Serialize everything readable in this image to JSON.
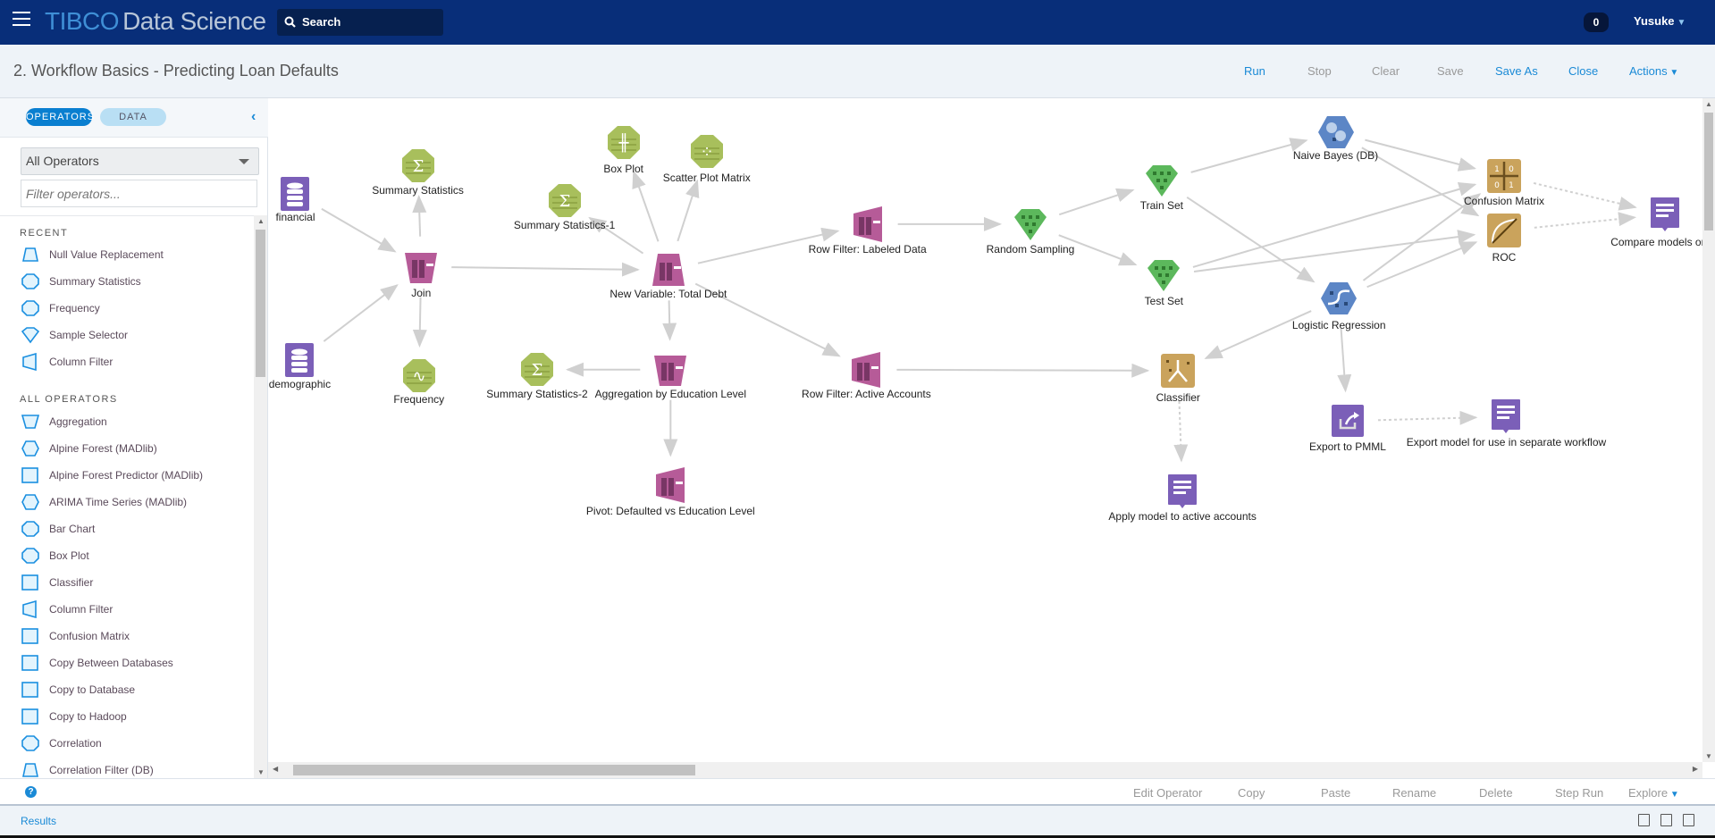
{
  "header": {
    "brand": "TIBCO",
    "product": "Data Science",
    "search_label": "Search",
    "notifications": "0",
    "user": "Yusuke"
  },
  "titlebar": {
    "title": "2. Workflow Basics - Predicting Loan Defaults",
    "buttons": [
      {
        "label": "Run",
        "enabled": true
      },
      {
        "label": "Stop",
        "enabled": false
      },
      {
        "label": "Clear",
        "enabled": false
      },
      {
        "label": "Save",
        "enabled": false
      },
      {
        "label": "Save As",
        "enabled": true
      },
      {
        "label": "Close",
        "enabled": true
      },
      {
        "label": "Actions",
        "enabled": true
      }
    ]
  },
  "sidebar": {
    "tabs": {
      "operators": "OPERATORS",
      "data": "DATA"
    },
    "category": "All Operators",
    "filter_placeholder": "Filter operators...",
    "recent_header": "RECENT",
    "recent": [
      {
        "label": "Null Value Replacement",
        "shape": "trapezoid"
      },
      {
        "label": "Summary Statistics",
        "shape": "octagon"
      },
      {
        "label": "Frequency",
        "shape": "octagon"
      },
      {
        "label": "Sample Selector",
        "shape": "gem"
      },
      {
        "label": "Column Filter",
        "shape": "quad"
      }
    ],
    "all_header": "ALL OPERATORS",
    "all": [
      {
        "label": "Aggregation",
        "shape": "inv-trapezoid"
      },
      {
        "label": "Alpine Forest (MADlib)",
        "shape": "hexagon"
      },
      {
        "label": "Alpine Forest Predictor (MADlib)",
        "shape": "square"
      },
      {
        "label": "ARIMA Time Series (MADlib)",
        "shape": "hexagon"
      },
      {
        "label": "Bar Chart",
        "shape": "octagon"
      },
      {
        "label": "Box Plot",
        "shape": "octagon"
      },
      {
        "label": "Classifier",
        "shape": "square"
      },
      {
        "label": "Column Filter",
        "shape": "quad"
      },
      {
        "label": "Confusion Matrix",
        "shape": "square"
      },
      {
        "label": "Copy Between Databases",
        "shape": "square"
      },
      {
        "label": "Copy to Database",
        "shape": "square"
      },
      {
        "label": "Copy to Hadoop",
        "shape": "square"
      },
      {
        "label": "Correlation",
        "shape": "octagon"
      },
      {
        "label": "Correlation Filter (DB)",
        "shape": "trapezoid"
      }
    ]
  },
  "canvas": {
    "colors": {
      "dataset": "#7b5fb8",
      "stats": "#a8bf5c",
      "transform": "#b65b98",
      "sample": "#5cb85c",
      "model": "#5c86c6",
      "evaluator": "#caa35c",
      "note": "#7b5fb8",
      "edge": "#d0d0d0"
    },
    "nodes": [
      {
        "label": "financial",
        "kind": "dataset",
        "icon": "database-icon"
      },
      {
        "label": "demographic",
        "kind": "dataset",
        "icon": "database-icon"
      },
      {
        "label": "Summary Statistics",
        "kind": "stats",
        "icon": "sigma-icon"
      },
      {
        "label": "Join",
        "kind": "transform",
        "icon": "join-icon"
      },
      {
        "label": "Frequency",
        "kind": "stats",
        "icon": "frequency-icon"
      },
      {
        "label": "Summary Statistics-1",
        "kind": "stats",
        "icon": "sigma-icon"
      },
      {
        "label": "Box Plot",
        "kind": "stats",
        "icon": "box-plot-icon"
      },
      {
        "label": "Scatter Plot Matrix",
        "kind": "stats",
        "icon": "scatter-icon"
      },
      {
        "label": "New Variable: Total Debt",
        "kind": "transform",
        "icon": "new-variable-icon"
      },
      {
        "label": "Summary Statistics-2",
        "kind": "stats",
        "icon": "sigma-icon"
      },
      {
        "label": "Aggregation by Education Level",
        "kind": "transform",
        "icon": "aggregation-icon"
      },
      {
        "label": "Pivot: Defaulted vs Education Level",
        "kind": "transform",
        "icon": "pivot-icon"
      },
      {
        "label": "Row Filter: Labeled Data",
        "kind": "transform",
        "icon": "row-filter-icon"
      },
      {
        "label": "Row Filter: Active Accounts",
        "kind": "transform",
        "icon": "row-filter-icon"
      },
      {
        "label": "Random Sampling",
        "kind": "sample",
        "icon": "sampling-icon"
      },
      {
        "label": "Train Set",
        "kind": "sample",
        "icon": "sample-selector-icon"
      },
      {
        "label": "Test Set",
        "kind": "sample",
        "icon": "sample-selector-icon"
      },
      {
        "label": "Naive Bayes (DB)",
        "kind": "model",
        "icon": "naive-bayes-icon"
      },
      {
        "label": "Logistic Regression",
        "kind": "model",
        "icon": "logistic-regression-icon"
      },
      {
        "label": "Confusion Matrix",
        "kind": "evaluator",
        "icon": "confusion-matrix-icon"
      },
      {
        "label": "ROC",
        "kind": "evaluator",
        "icon": "roc-icon"
      },
      {
        "label": "Compare models on te",
        "kind": "note",
        "icon": "note-icon"
      },
      {
        "label": "Classifier",
        "kind": "evaluator",
        "icon": "classifier-icon"
      },
      {
        "label": "Apply model to active accounts",
        "kind": "note",
        "icon": "note-icon"
      },
      {
        "label": "Export to PMML",
        "kind": "dataset",
        "icon": "export-icon"
      },
      {
        "label": "Export model for use in separate workflow",
        "kind": "note",
        "icon": "note-icon"
      }
    ],
    "edges": [
      [
        0,
        3
      ],
      [
        1,
        3
      ],
      [
        3,
        2
      ],
      [
        3,
        4
      ],
      [
        3,
        8
      ],
      [
        8,
        5
      ],
      [
        8,
        6
      ],
      [
        8,
        7
      ],
      [
        8,
        12
      ],
      [
        8,
        13
      ],
      [
        8,
        10
      ],
      [
        10,
        9
      ],
      [
        10,
        11
      ],
      [
        12,
        14
      ],
      [
        14,
        15
      ],
      [
        14,
        16
      ],
      [
        15,
        17
      ],
      [
        15,
        18
      ],
      [
        17,
        19
      ],
      [
        17,
        20
      ],
      [
        16,
        19
      ],
      [
        16,
        20
      ],
      [
        18,
        19
      ],
      [
        18,
        20
      ],
      [
        18,
        22
      ],
      [
        13,
        22
      ],
      [
        18,
        24
      ]
    ],
    "dashed_edges": [
      [
        19,
        21
      ],
      [
        20,
        21
      ],
      [
        22,
        23
      ],
      [
        24,
        25
      ]
    ]
  },
  "bottombar": {
    "help": "?",
    "buttons": [
      "Edit Operator",
      "Copy",
      "Paste",
      "Rename",
      "Delete",
      "Step Run",
      "Explore"
    ]
  },
  "resultsbar": {
    "label": "Results"
  }
}
